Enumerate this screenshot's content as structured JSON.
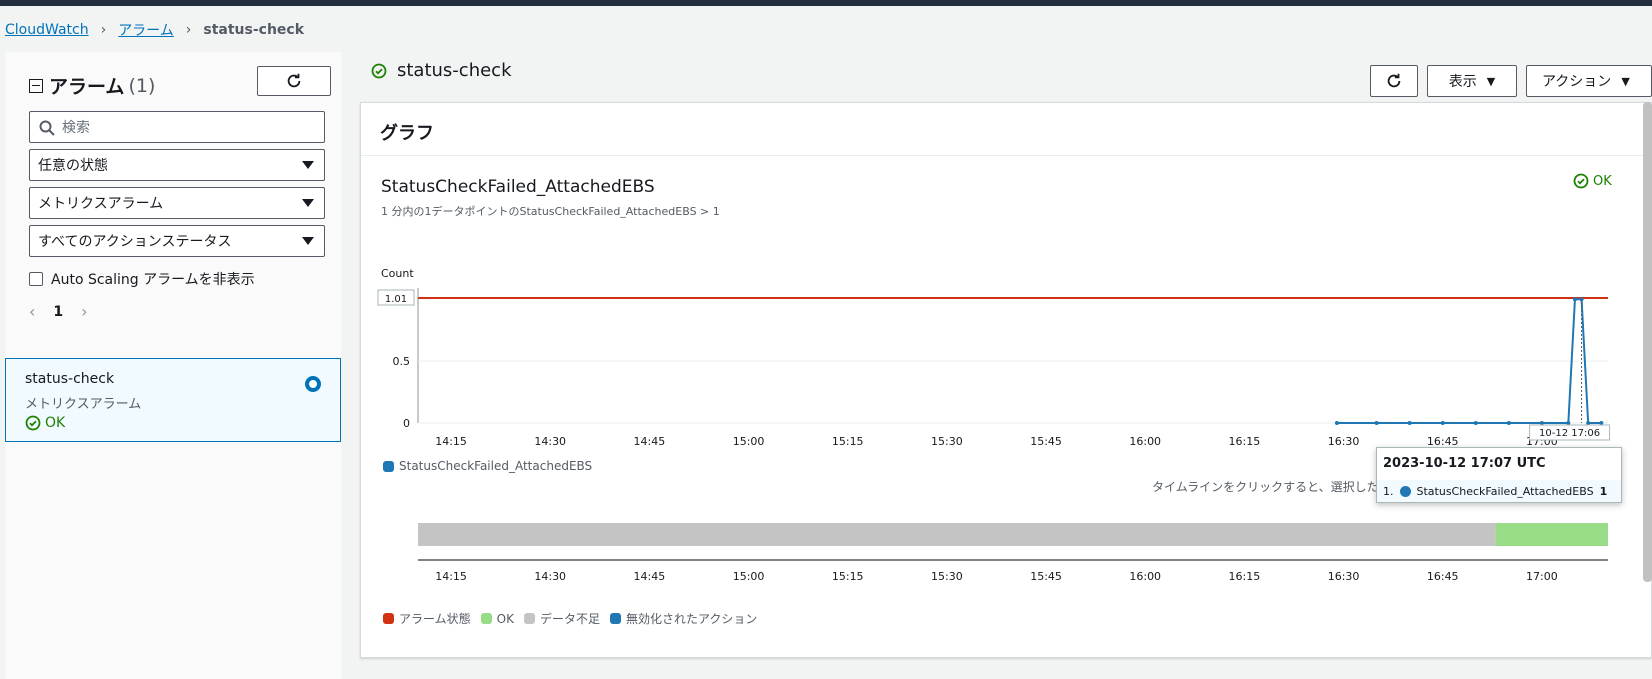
{
  "breadcrumb": {
    "root": "CloudWatch",
    "alarms": "アラーム",
    "current": "status-check"
  },
  "sidebar": {
    "title": "アラーム",
    "count": "(1)",
    "search_placeholder": "検索",
    "filter_state": "任意の状態",
    "filter_type": "メトリクスアラーム",
    "filter_action": "すべてのアクションステータス",
    "hide_autoscaling": "Auto Scaling アラームを非表示",
    "page": "1",
    "alarm": {
      "name": "status-check",
      "type": "メトリクスアラーム",
      "state": "OK"
    }
  },
  "main": {
    "title": "status-check",
    "view_label": "表示",
    "actions_label": "アクション",
    "panel_title": "グラフ",
    "graph_title": "StatusCheckFailed_AttachedEBS",
    "graph_subtitle": "1 分内の1データポイントのStatusCheckFailed_AttachedEBS > 1",
    "graph_state": "OK",
    "hint": "タイムラインをクリックすると、選択した"
  },
  "colors": {
    "accent": "#0073bb",
    "ok": "#1d8102",
    "alarm": "#d13212",
    "series": "#1f77b4",
    "insufficient": "#c4c4c4",
    "ok_band": "#98dc88"
  },
  "tooltip": {
    "time": "2023-10-12 17:07 UTC",
    "index": "1.",
    "series": "StatusCheckFailed_AttachedEBS",
    "value": "1"
  },
  "chart_data": {
    "type": "line",
    "ylabel": "Count",
    "yticks": [
      "0",
      "0.5"
    ],
    "ylim": [
      0,
      1.01
    ],
    "threshold": 1.01,
    "threshold_label": "1.01",
    "xticks": [
      "14:15",
      "14:30",
      "14:45",
      "15:00",
      "15:15",
      "15:30",
      "15:45",
      "16:00",
      "16:15",
      "16:30",
      "16:45",
      "17:00"
    ],
    "x_hover_label": "10-12 17:06",
    "series": [
      {
        "name": "StatusCheckFailed_AttachedEBS",
        "points": [
          [
            "16:29",
            0
          ],
          [
            "16:35",
            0
          ],
          [
            "16:40",
            0
          ],
          [
            "16:45",
            0
          ],
          [
            "16:50",
            0
          ],
          [
            "16:55",
            0
          ],
          [
            "17:00",
            0
          ],
          [
            "17:04",
            0
          ],
          [
            "17:05",
            1
          ],
          [
            "17:06",
            1
          ],
          [
            "17:07",
            0
          ],
          [
            "17:09",
            0
          ]
        ]
      }
    ],
    "legend": [
      "StatusCheckFailed_AttachedEBS"
    ],
    "timeline": {
      "xticks": [
        "14:15",
        "14:30",
        "14:45",
        "15:00",
        "15:15",
        "15:30",
        "15:45",
        "16:00",
        "16:15",
        "16:30",
        "16:45",
        "17:00"
      ],
      "segments": [
        {
          "state": "insufficient",
          "start": "14:10",
          "end": "16:53"
        },
        {
          "state": "ok",
          "start": "16:53",
          "end": "17:10"
        }
      ],
      "legend": [
        "アラーム状態",
        "OK",
        "データ不足",
        "無効化されたアクション"
      ]
    }
  }
}
